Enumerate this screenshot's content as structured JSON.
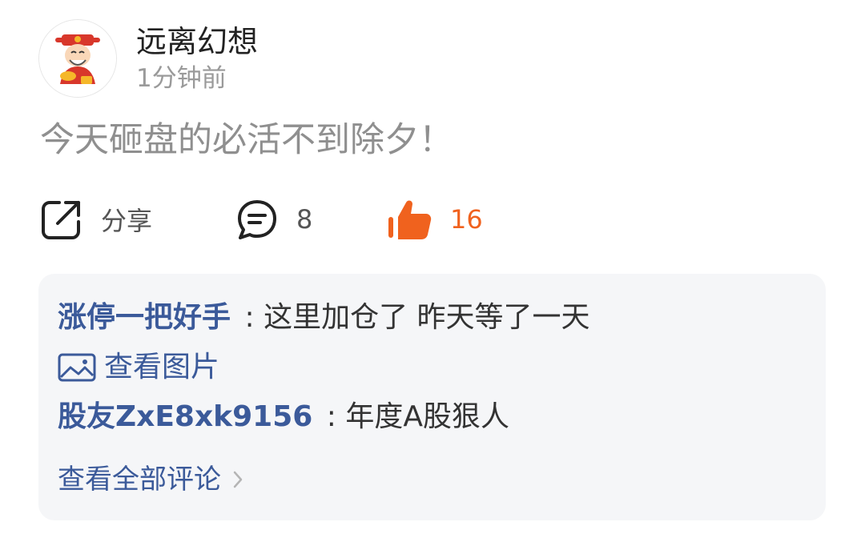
{
  "post": {
    "author": "远离幻想",
    "time": "1分钟前",
    "text": "今天砸盘的必活不到除夕！"
  },
  "actions": {
    "share_label": "分享",
    "comment_count": "8",
    "like_count": "16",
    "like_color": "#f0621e"
  },
  "comments": {
    "items": [
      {
        "author": "涨停一把好手",
        "separator": ":",
        "text": "这里加仓了  昨天等了一天"
      },
      {
        "author": "股友ZxE8xk9156",
        "separator": ":",
        "text": "年度A股狠人"
      }
    ],
    "image_link_label": "查看图片",
    "view_all_label": "查看全部评论"
  },
  "icons": {
    "share": "share-icon",
    "comment": "comment-bubble-icon",
    "like": "thumbs-up-icon",
    "image": "image-icon",
    "chevron": "chevron-right-icon"
  }
}
